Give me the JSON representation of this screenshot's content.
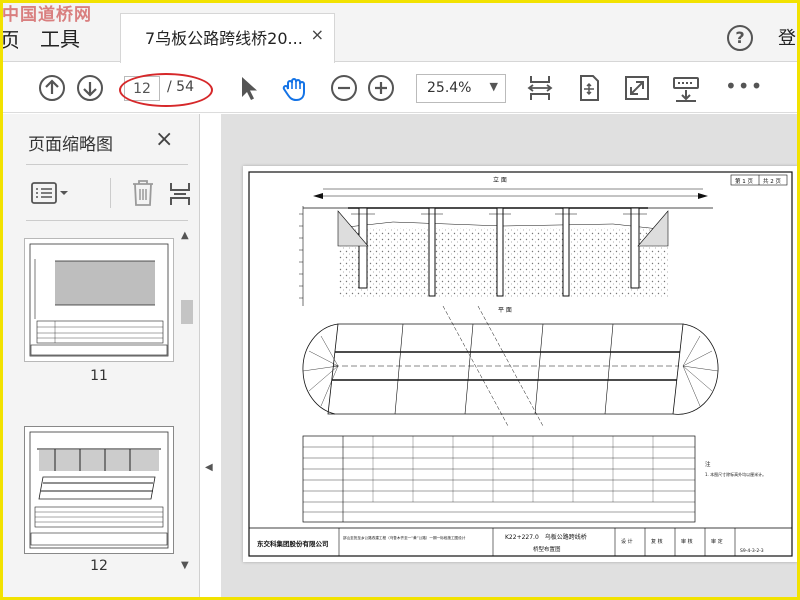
{
  "watermark": "中国道桥网",
  "menu": {
    "view_cut": "页",
    "tools": "工具"
  },
  "tab": {
    "title": "7乌板公路跨线桥20...",
    "close": "×"
  },
  "header": {
    "help": "?",
    "login_cut": "登"
  },
  "toolbar": {
    "prev_icon": "arrow-up-icon",
    "next_icon": "arrow-down-icon",
    "page_current": "12",
    "page_total": "/ 54",
    "zoom": "25.4%",
    "more": "•••"
  },
  "sidebar": {
    "title": "页面缩略图",
    "close": "×",
    "thumbs": [
      {
        "label": "11"
      },
      {
        "label": "12"
      }
    ]
  },
  "drawing": {
    "section_title": "立 面",
    "plan_title": "平 面",
    "sheet_no_1": "第 1 页",
    "sheet_no_2": "共 2 页",
    "company": "东交科集团股份有限公司",
    "project": "邵山至抚至乡公路改建工程（乌鲁木齐至一“黄”公路）一期一标段施工图设计",
    "station": "K22+227.0　乌板公路跨线桥",
    "drawing_name": "桥型布置图",
    "design": "设 计",
    "review": "复 核",
    "check": "审 核",
    "approve": "审 定",
    "code": "S9-4-3-2-3",
    "note_title": "注",
    "note1": "1. 本图尺寸除标高外均以厘米计。"
  },
  "colors": {
    "highlight_oval": "#d6282a",
    "frame": "#f2e200",
    "watermark": "#c32020"
  }
}
